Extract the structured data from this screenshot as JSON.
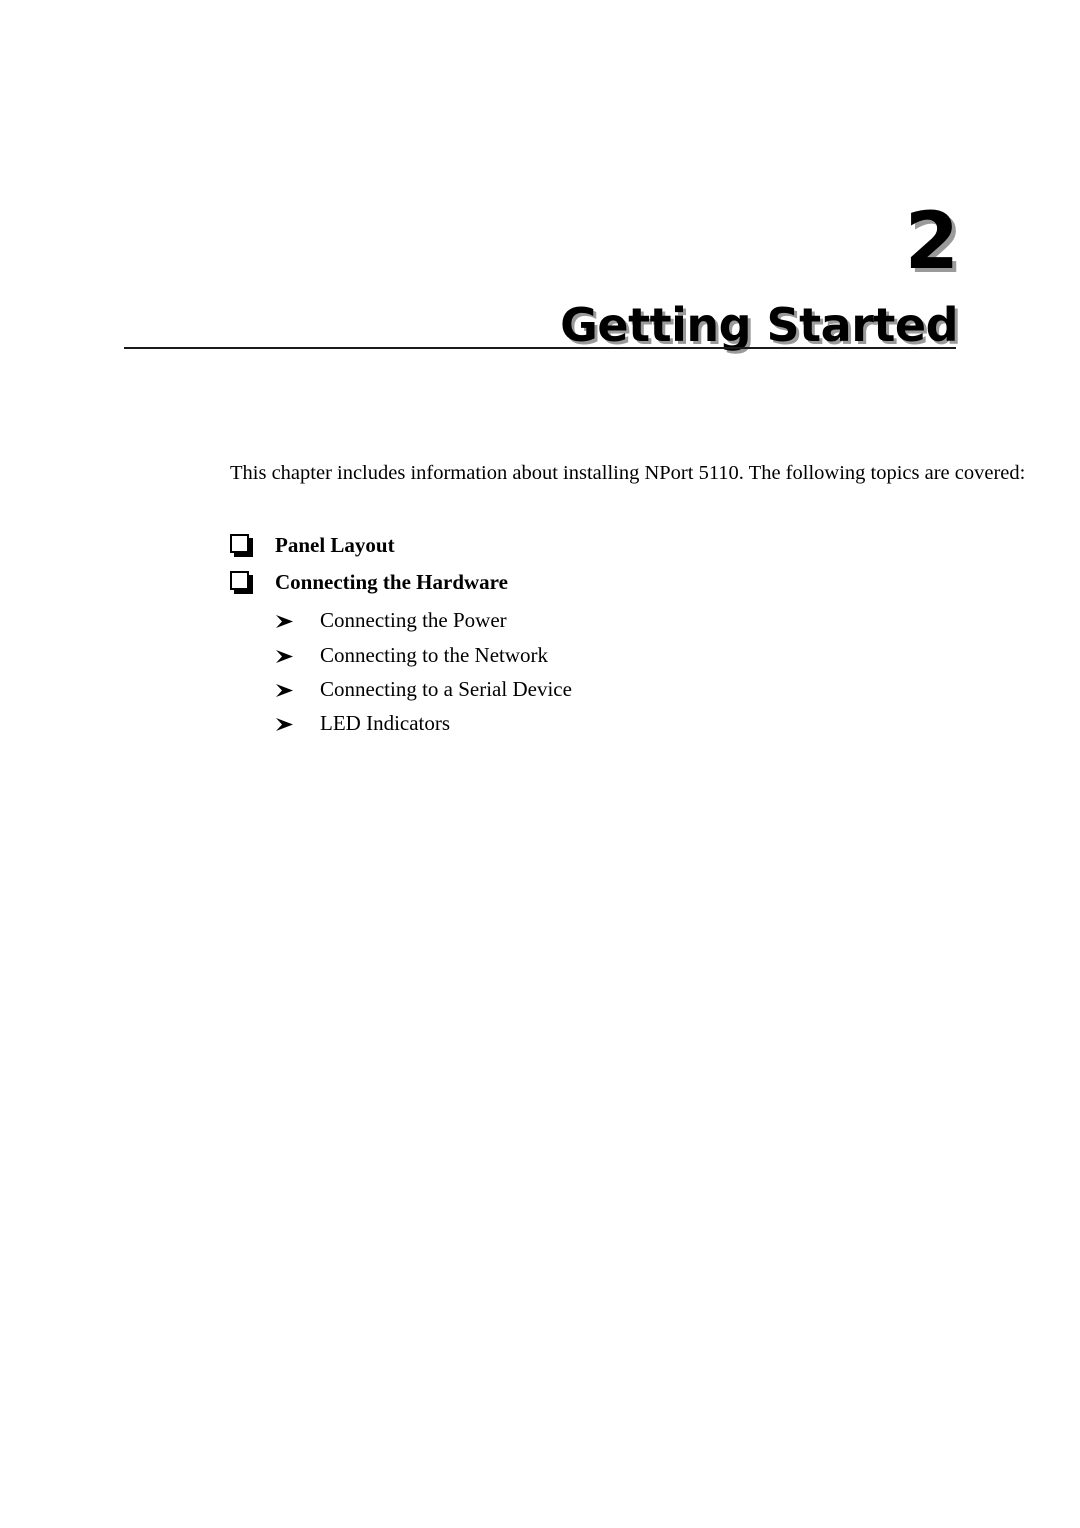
{
  "chapter": {
    "number": "2",
    "title": "Getting Started"
  },
  "intro": {
    "paragraph": "This chapter includes information about installing NPort 5110. The following topics are covered:"
  },
  "topics": [
    {
      "label": "Panel Layout",
      "marker": "checkbox-glyph",
      "subtopics": []
    },
    {
      "label": "Connecting the Hardware",
      "marker": "checkbox-glyph",
      "subtopics": [
        {
          "label": "Connecting the Power",
          "marker": "arrow-glyph"
        },
        {
          "label": "Connecting to the Network",
          "marker": "arrow-glyph"
        },
        {
          "label": "Connecting to a Serial Device",
          "marker": "arrow-glyph"
        },
        {
          "label": "LED Indicators",
          "marker": "arrow-glyph"
        }
      ]
    }
  ],
  "colors": {
    "text": "#000000",
    "page_background": "#ffffff",
    "rule": "#1a1a1a",
    "title_shadow": "#9a9a9a"
  }
}
